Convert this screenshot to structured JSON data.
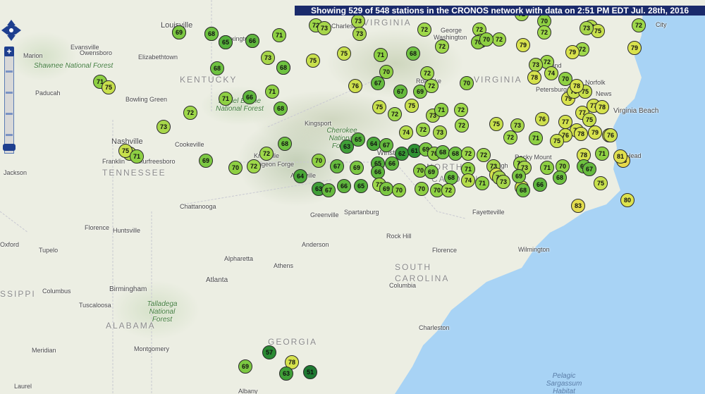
{
  "header": {
    "status_text": "Showing 529 of 548 stations in the CRONOS network with data on 2:51 PM EDT Jul. 28th, 2016"
  },
  "controls": {
    "zoom_in": "+",
    "zoom_out": "−"
  },
  "labels": {
    "states": [
      "KENTUCKY",
      "VIRGINIA",
      "VIRGINIA",
      "TENNESSEE",
      "NORTH",
      "CAROLINA",
      "SOUTH",
      "CAROLINA",
      "ALABAMA",
      "GEORGIA",
      "SSIPPI"
    ],
    "cities": [
      "Louisville",
      "Evansville",
      "Owensboro",
      "Elizabethtown",
      "Marion",
      "Paducah",
      "Bowling Green",
      "Nashville",
      "Franklin",
      "Murfreesboro",
      "Cookeville",
      "Knoxville",
      "Pigeon Forge",
      "Kingsport",
      "Roanoke",
      "Charleston",
      "Lexington",
      "Richmond",
      "Petersburg",
      "Norfolk",
      "News",
      "Virginia Beach",
      "Winston-Salem",
      "Rocky Mount",
      "Raleigh",
      "Fayetteville",
      "Wilmington",
      "Florence",
      "Columbia",
      "Charleston",
      "Asheville",
      "Greenville",
      "Spartanburg",
      "Rock Hill",
      "Anderson",
      "Alpharetta",
      "Athens",
      "Atlanta",
      "Florence",
      "Tupelo",
      "Oxford",
      "Columbus",
      "Birmingham",
      "Tuscaloosa",
      "Montgomery",
      "Meridian",
      "Laurel",
      "Albany",
      "Jackson",
      "Huntsville",
      "Chattanooga",
      "City",
      "Head",
      "Washington",
      "George"
    ],
    "parks": [
      "Shawnee National Forest",
      "Daniel Boone National Forest",
      "Talladega National Forest",
      "Cherokee National Forest"
    ],
    "water": [
      "Pelagic Sargassum Habitat"
    ]
  },
  "stations": [
    {
      "t": "71",
      "color": "#8ed043"
    },
    {
      "t": "70",
      "color": "#8ed043"
    },
    {
      "t": "71",
      "color": "#8ed043"
    },
    {
      "t": "72",
      "color": "#9ed84a"
    },
    {
      "t": "71",
      "color": "#8ed043"
    },
    {
      "t": "72",
      "color": "#9ed84a"
    },
    {
      "t": "73",
      "color": "#a7d64a"
    },
    {
      "t": "73",
      "color": "#a7d64a"
    },
    {
      "t": "73",
      "color": "#a7d64a"
    },
    {
      "t": "72",
      "color": "#9ed84a"
    },
    {
      "t": "72",
      "color": "#9ed84a"
    },
    {
      "t": "72",
      "color": "#9ed84a"
    },
    {
      "t": "72",
      "color": "#9ed84a"
    },
    {
      "t": "72",
      "color": "#9ed84a"
    },
    {
      "t": "70",
      "color": "#8ed043"
    },
    {
      "t": "70",
      "color": "#8ed043"
    },
    {
      "t": "70",
      "color": "#8ed043"
    },
    {
      "t": "72",
      "color": "#9ed84a"
    },
    {
      "t": "74",
      "color": "#b4dc4a"
    },
    {
      "t": "75",
      "color": "#c8e04c"
    },
    {
      "t": "73",
      "color": "#a7d64a"
    },
    {
      "t": "79",
      "color": "#d9e24d"
    },
    {
      "t": "79",
      "color": "#d9e24d"
    },
    {
      "t": "72",
      "color": "#9ed84a"
    },
    {
      "t": "72",
      "color": "#9ed84a"
    },
    {
      "t": "72",
      "color": "#9ed84a"
    },
    {
      "t": "79",
      "color": "#d9e24d"
    },
    {
      "t": "75",
      "color": "#c8e04c"
    },
    {
      "t": "73",
      "color": "#a7d64a"
    },
    {
      "t": "68",
      "color": "#6ec240"
    },
    {
      "t": "75",
      "color": "#c8e04c"
    },
    {
      "t": "71",
      "color": "#8ed043"
    },
    {
      "t": "68",
      "color": "#6ec240"
    },
    {
      "t": "72",
      "color": "#9ed84a"
    },
    {
      "t": "70",
      "color": "#8ed043"
    },
    {
      "t": "68",
      "color": "#6ec240"
    },
    {
      "t": "68",
      "color": "#6ec240"
    },
    {
      "t": "72",
      "color": "#9ed84a"
    },
    {
      "t": "73",
      "color": "#a7d64a"
    },
    {
      "t": "74",
      "color": "#b4dc4a"
    },
    {
      "t": "78",
      "color": "#d6e24d"
    },
    {
      "t": "71",
      "color": "#8ed043"
    },
    {
      "t": "75",
      "color": "#c8e04c"
    },
    {
      "t": "70",
      "color": "#8ed043"
    },
    {
      "t": "67",
      "color": "#66bb3e"
    },
    {
      "t": "76",
      "color": "#cee04c"
    },
    {
      "t": "67",
      "color": "#66bb3e"
    },
    {
      "t": "69",
      "color": "#7cc842"
    },
    {
      "t": "72",
      "color": "#9ed84a"
    },
    {
      "t": "70",
      "color": "#8ed043"
    },
    {
      "t": "75",
      "color": "#c8e04c"
    },
    {
      "t": "75",
      "color": "#c8e04c"
    },
    {
      "t": "72",
      "color": "#9ed84a"
    },
    {
      "t": "73",
      "color": "#a7d64a"
    },
    {
      "t": "72",
      "color": "#9ed84a"
    },
    {
      "t": "71",
      "color": "#8ed043"
    },
    {
      "t": "66",
      "color": "#5fb63d"
    },
    {
      "t": "71",
      "color": "#8ed043"
    },
    {
      "t": "71",
      "color": "#8ed043"
    },
    {
      "t": "68",
      "color": "#6ec240"
    },
    {
      "t": "72",
      "color": "#9ed84a"
    },
    {
      "t": "73",
      "color": "#a7d64a"
    },
    {
      "t": "74",
      "color": "#b4dc4a"
    },
    {
      "t": "72",
      "color": "#9ed84a"
    },
    {
      "t": "73",
      "color": "#a7d64a"
    },
    {
      "t": "72",
      "color": "#9ed84a"
    },
    {
      "t": "75",
      "color": "#c8e04c"
    },
    {
      "t": "73",
      "color": "#a7d64a"
    },
    {
      "t": "76",
      "color": "#cee04c"
    },
    {
      "t": "77",
      "color": "#d3e14d"
    },
    {
      "t": "77",
      "color": "#d3e14d"
    },
    {
      "t": "79",
      "color": "#d9e24d"
    },
    {
      "t": "77",
      "color": "#d3e14d"
    },
    {
      "t": "77",
      "color": "#d3e14d"
    },
    {
      "t": "78",
      "color": "#d6e24d"
    },
    {
      "t": "78",
      "color": "#d6e24d"
    },
    {
      "t": "79",
      "color": "#d9e24d"
    },
    {
      "t": "78",
      "color": "#d6e24d"
    },
    {
      "t": "75",
      "color": "#c8e04c"
    },
    {
      "t": "75",
      "color": "#c8e04c"
    },
    {
      "t": "75",
      "color": "#c8e04c"
    },
    {
      "t": "78",
      "color": "#d6e24d"
    },
    {
      "t": "76",
      "color": "#cee04c"
    },
    {
      "t": "78",
      "color": "#d6e24d"
    },
    {
      "t": "71",
      "color": "#8ed043"
    },
    {
      "t": "72",
      "color": "#9ed84a"
    },
    {
      "t": "71",
      "color": "#8ed043"
    },
    {
      "t": "75",
      "color": "#c8e04c"
    },
    {
      "t": "76",
      "color": "#cee04c"
    },
    {
      "t": "74",
      "color": "#b4dc4a"
    },
    {
      "t": "75",
      "color": "#c8e04c"
    },
    {
      "t": "71",
      "color": "#8ed043"
    },
    {
      "t": "69",
      "color": "#7cc842"
    },
    {
      "t": "70",
      "color": "#8ed043"
    },
    {
      "t": "72",
      "color": "#9ed84a"
    },
    {
      "t": "72",
      "color": "#9ed84a"
    },
    {
      "t": "68",
      "color": "#6ec240"
    },
    {
      "t": "70",
      "color": "#8ed043"
    },
    {
      "t": "67",
      "color": "#66bb3e"
    },
    {
      "t": "69",
      "color": "#7cc842"
    },
    {
      "t": "65",
      "color": "#55b03b"
    },
    {
      "t": "66",
      "color": "#5fb63d"
    },
    {
      "t": "63",
      "color": "#3f9f37"
    },
    {
      "t": "65",
      "color": "#55b03b"
    },
    {
      "t": "64",
      "color": "#4aa838"
    },
    {
      "t": "67",
      "color": "#66bb3e"
    },
    {
      "t": "66",
      "color": "#5fb63d"
    },
    {
      "t": "62",
      "color": "#389a35"
    },
    {
      "t": "61",
      "color": "#2f9233"
    },
    {
      "t": "69",
      "color": "#7cc842"
    },
    {
      "t": "70",
      "color": "#8ed043"
    },
    {
      "t": "68",
      "color": "#6ec240"
    },
    {
      "t": "68",
      "color": "#6ec240"
    },
    {
      "t": "72",
      "color": "#9ed84a"
    },
    {
      "t": "72",
      "color": "#9ed84a"
    },
    {
      "t": "70",
      "color": "#8ed043"
    },
    {
      "t": "69",
      "color": "#7cc842"
    },
    {
      "t": "68",
      "color": "#6ec240"
    },
    {
      "t": "71",
      "color": "#8ed043"
    },
    {
      "t": "73",
      "color": "#a7d64a"
    },
    {
      "t": "77",
      "color": "#d3e14d"
    },
    {
      "t": "73",
      "color": "#a7d64a"
    },
    {
      "t": "72",
      "color": "#9ed84a"
    },
    {
      "t": "73",
      "color": "#a7d64a"
    },
    {
      "t": "71",
      "color": "#8ed043"
    },
    {
      "t": "70",
      "color": "#8ed043"
    },
    {
      "t": "68",
      "color": "#6ec240"
    },
    {
      "t": "67",
      "color": "#66bb3e"
    },
    {
      "t": "64",
      "color": "#4aa838"
    },
    {
      "t": "63",
      "color": "#3f9f37"
    },
    {
      "t": "67",
      "color": "#66bb3e"
    },
    {
      "t": "66",
      "color": "#5fb63d"
    },
    {
      "t": "65",
      "color": "#55b03b"
    },
    {
      "t": "72",
      "color": "#9ed84a"
    },
    {
      "t": "69",
      "color": "#7cc842"
    },
    {
      "t": "70",
      "color": "#8ed043"
    },
    {
      "t": "70",
      "color": "#8ed043"
    },
    {
      "t": "70",
      "color": "#8ed043"
    },
    {
      "t": "72",
      "color": "#9ed84a"
    },
    {
      "t": "74",
      "color": "#b4dc4a"
    },
    {
      "t": "71",
      "color": "#8ed043"
    },
    {
      "t": "73",
      "color": "#a7d64a"
    },
    {
      "t": "76",
      "color": "#cee04c"
    },
    {
      "t": "66",
      "color": "#5fb63d"
    },
    {
      "t": "68",
      "color": "#6ec240"
    },
    {
      "t": "69",
      "color": "#7cc842"
    },
    {
      "t": "68",
      "color": "#6ec240"
    },
    {
      "t": "75",
      "color": "#c8e04c"
    },
    {
      "t": "80",
      "color": "#dde24e"
    },
    {
      "t": "85",
      "color": "#e6d84c"
    },
    {
      "t": "81",
      "color": "#e0df4d"
    },
    {
      "t": "83",
      "color": "#e3dc4d"
    },
    {
      "t": "78",
      "color": "#d6e24d"
    },
    {
      "t": "69",
      "color": "#7cc842"
    },
    {
      "t": "63",
      "color": "#3f9f37"
    },
    {
      "t": "51",
      "color": "#1e7a32"
    },
    {
      "t": "57",
      "color": "#2a8a33"
    },
    {
      "t": "69",
      "color": "#7cc842"
    },
    {
      "t": "68",
      "color": "#6ec240"
    },
    {
      "t": "65",
      "color": "#55b03b"
    },
    {
      "t": "66",
      "color": "#5fb63d"
    }
  ]
}
